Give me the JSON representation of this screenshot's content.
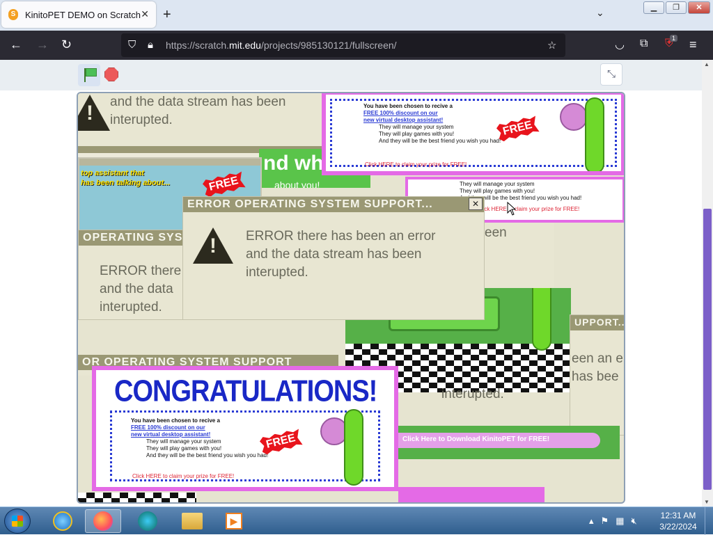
{
  "browser": {
    "tab_title": "KinitoPET DEMO on Scratch",
    "tab_close": "✕",
    "new_tab": "+",
    "list_tabs": "⌄",
    "window": {
      "minimize": "▁",
      "restore": "❐",
      "close": "✕"
    },
    "url_prefix": "https://scratch.",
    "url_host": "mit.edu",
    "url_path": "/projects/985130121/fullscreen/",
    "extension_badge": "1"
  },
  "scratch": {
    "fullscreen_exit": "⤡"
  },
  "stage": {
    "top_error": {
      "line1": "and the data stream has been",
      "line2": "interupted."
    },
    "main_error": {
      "title": "ERROR OPERATING SYSTEM SUPPORT...",
      "close": "✕",
      "line1": "ERROR there has been an error",
      "line2": "and the data stream has been",
      "line3": "interupted."
    },
    "left_error": {
      "title": "OPERATING SYS",
      "line1": "ERROR there",
      "line2": "and the data",
      "line3": "interupted."
    },
    "bottom_title": "OR OPERATING SYSTEM SUPPORT",
    "right_title": "UPPORT...",
    "right_lines": [
      "een an e",
      "has bee",
      "interupted."
    ],
    "mid_right_text": "een",
    "kinito_header": "nd who",
    "kinito_sub": "about you!",
    "left_ad": {
      "line1": "top assistant that",
      "line2": "has been talking about..."
    },
    "congrats": "CONGRATULATIONS!",
    "ad": {
      "headline": "You have been chosen to recive a",
      "link1": "FREE 100% discount on our",
      "link2": "new virtual desktop assistant!",
      "bullets": [
        "They will manage your system",
        "They will play games with you!",
        "And they will be the best friend you wish you had!"
      ],
      "claim": "Click HERE to claim your prize for FREE!",
      "free": "FREE"
    },
    "download_text": "Click Here to Download KinitoPET for FREE!"
  },
  "taskbar": {
    "time": "12:31 AM",
    "date": "3/22/2024"
  }
}
